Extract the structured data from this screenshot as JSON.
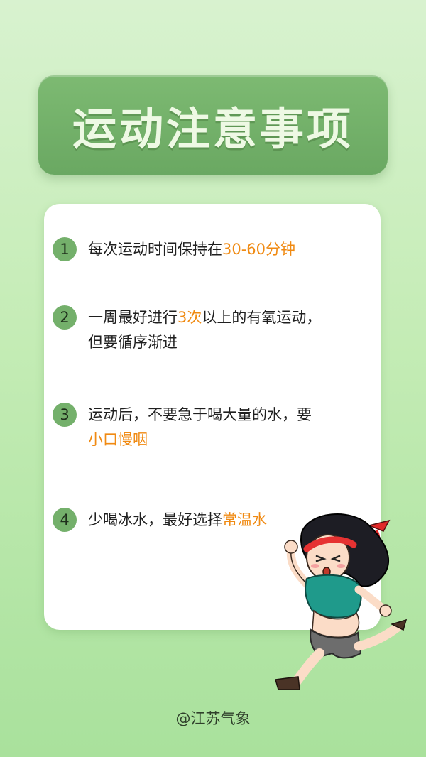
{
  "title": "运动注意事项",
  "items": [
    {
      "num": "1",
      "lines": [
        [
          {
            "t": "每次运动时间保持在"
          },
          {
            "t": "30-60分钟",
            "hl": true
          }
        ]
      ]
    },
    {
      "num": "2",
      "lines": [
        [
          {
            "t": "一周最好进行"
          },
          {
            "t": "3次",
            "hl": true
          },
          {
            "t": "以上的有氧运动，"
          }
        ],
        [
          {
            "t": "但要循序渐进"
          }
        ]
      ]
    },
    {
      "num": "3",
      "lines": [
        [
          {
            "t": "运动后，不要急于喝大量的水，要"
          }
        ],
        [
          {
            "t": "小口慢咽",
            "hl": true
          }
        ]
      ]
    },
    {
      "num": "4",
      "lines": [
        [
          {
            "t": "少喝冰水，最好选择"
          },
          {
            "t": "常温水",
            "hl": true
          }
        ]
      ]
    }
  ],
  "footer": "@江苏气象",
  "colors": {
    "accent": "#f08a12",
    "badge": "#74b06b",
    "title_bg": "#72b068"
  },
  "illustration": "running-girl-cartoon"
}
